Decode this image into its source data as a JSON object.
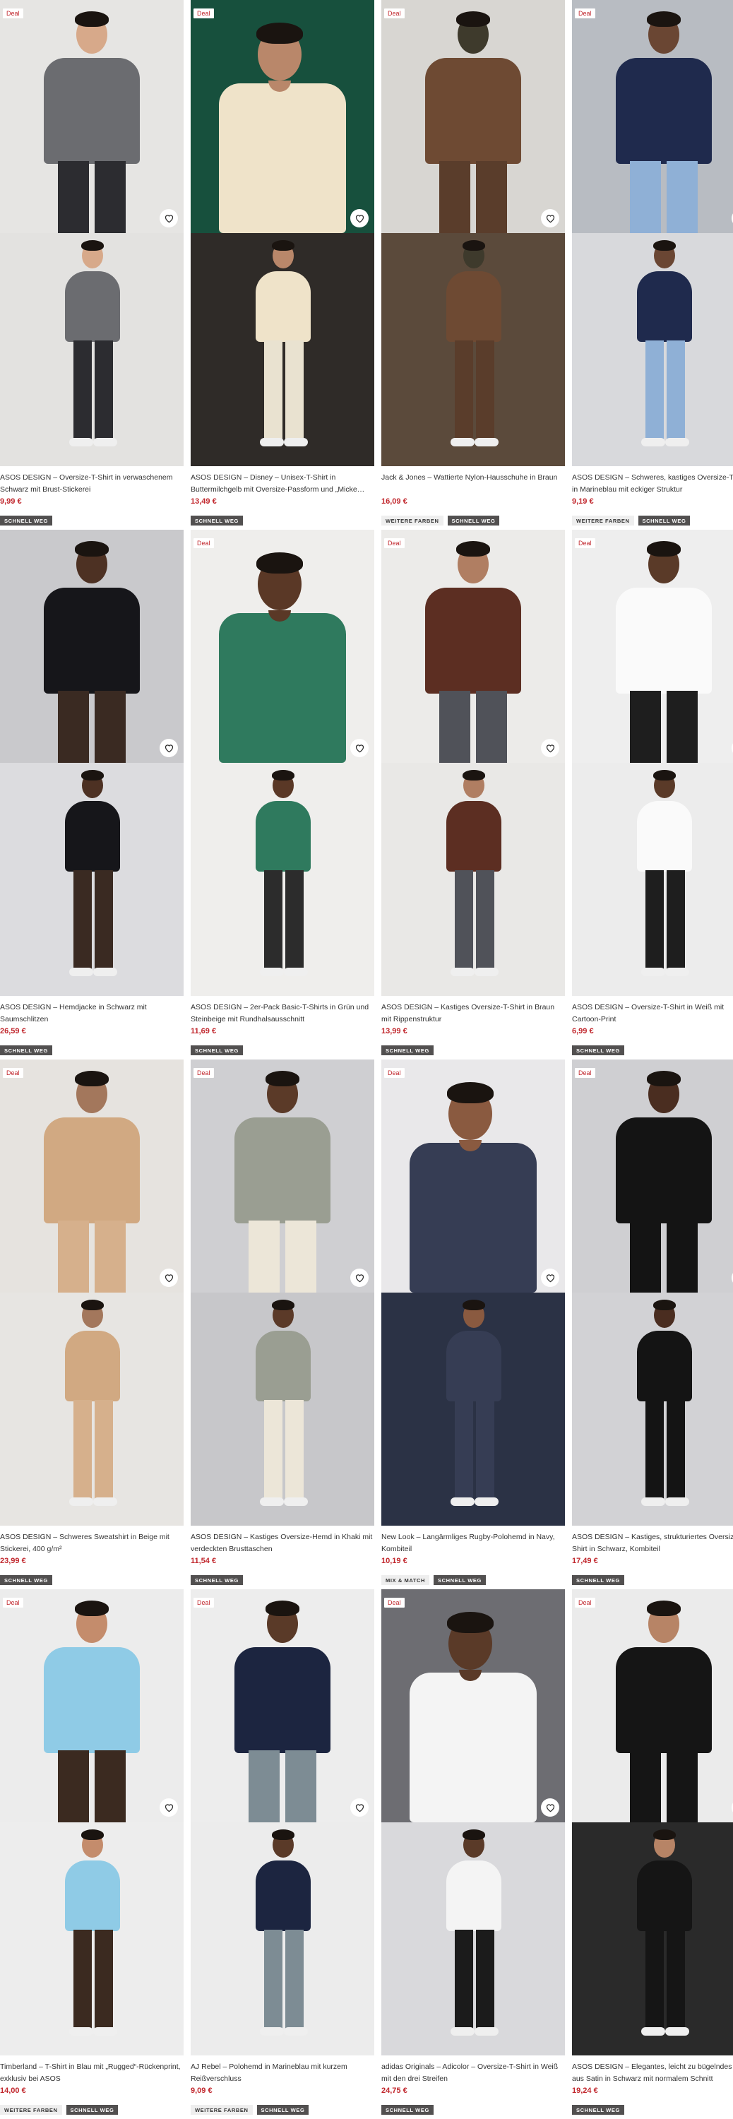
{
  "products": [
    {
      "title": "ASOS DESIGN – Oversize-T-Shirt in verwaschenem Schwarz mit Brust-Stickerei",
      "price": "9,99 €",
      "deal": "Deal",
      "badges": [
        "SCHNELL WEG"
      ],
      "colors": {
        "bg": "#e6e5e3",
        "bg2": "#e3e2e0",
        "shirt": "#6b6c70",
        "pants": "#2c2c30",
        "skin": "#d7a98a"
      }
    },
    {
      "title": "ASOS DESIGN – Disney – Unisex-T-Shirt in Buttermilchgelb mit Oversize-Passform und „Micke…",
      "price": "13,49 €",
      "deal": "Deal",
      "badges": [
        "SCHNELL WEG"
      ],
      "colors": {
        "bg": "#17503d",
        "bg2": "#2f2b28",
        "shirt": "#efe3c9",
        "pants": "#e9e2d0",
        "skin": "#b9876a"
      }
    },
    {
      "title": "Jack & Jones – Wattierte Nylon-Hausschuhe in Braun",
      "price": "16,09 €",
      "deal": "Deal",
      "badges": [
        "WEITERE FARBEN",
        "SCHNELL WEG"
      ],
      "colors": {
        "bg": "#d8d6d2",
        "bg2": "#5b4a3b",
        "shirt": "#6e4a33",
        "pants": "#5a3d2b",
        "skin": "#3e3a2c"
      }
    },
    {
      "title": "ASOS DESIGN – Schweres, kastiges Oversize-T-Shirt in Marineblau mit eckiger Struktur",
      "price": "9,19 €",
      "deal": "Deal",
      "badges": [
        "WEITERE FARBEN",
        "SCHNELL WEG"
      ],
      "colors": {
        "bg": "#b8bcc2",
        "bg2": "#d8d9dc",
        "shirt": "#1f2a4d",
        "pants": "#8fb0d6",
        "skin": "#6a4633"
      }
    },
    {
      "title": "ASOS DESIGN – Hemdjacke in Schwarz mit Saumschlitzen",
      "price": "26,59 €",
      "deal": "",
      "badges": [
        "SCHNELL WEG"
      ],
      "colors": {
        "bg": "#c9c9cc",
        "bg2": "#dcdcdf",
        "shirt": "#16161a",
        "pants": "#3a2a22",
        "skin": "#4d3123"
      }
    },
    {
      "title": "ASOS DESIGN – 2er-Pack Basic-T-Shirts in Grün und Steinbeige mit Rundhalsausschnitt",
      "price": "11,69 €",
      "deal": "Deal",
      "badges": [
        "SCHNELL WEG"
      ],
      "colors": {
        "bg": "#efeeec",
        "bg2": "#efeeec",
        "shirt": "#2f7a5e",
        "pants": "#2c2c2c",
        "skin": "#5a3826"
      }
    },
    {
      "title": "ASOS DESIGN – Kastiges Oversize-T-Shirt in Braun mit Rippenstruktur",
      "price": "13,99 €",
      "deal": "Deal",
      "badges": [
        "SCHNELL WEG"
      ],
      "colors": {
        "bg": "#ecebe9",
        "bg2": "#e9e8e6",
        "shirt": "#5c2e22",
        "pants": "#505259",
        "skin": "#b07e62"
      }
    },
    {
      "title": "ASOS DESIGN – Oversize-T-Shirt in Weiß mit Cartoon-Print",
      "price": "6,99 €",
      "deal": "Deal",
      "badges": [
        "SCHNELL WEG"
      ],
      "colors": {
        "bg": "#eeeeee",
        "bg2": "#ececec",
        "shirt": "#fafafa",
        "pants": "#1e1e1e",
        "skin": "#5a3a28"
      }
    },
    {
      "title": "ASOS DESIGN – Schweres Sweatshirt in Beige mit Stickerei, 400 g/m²",
      "price": "23,99 €",
      "deal": "Deal",
      "badges": [
        "SCHNELL WEG"
      ],
      "colors": {
        "bg": "#e6e3df",
        "bg2": "#e7e5e2",
        "shirt": "#d1a982",
        "pants": "#d6b08c",
        "skin": "#a3775c"
      }
    },
    {
      "title": "ASOS DESIGN – Kastiges Oversize-Hemd in Khaki mit verdeckten Brusttaschen",
      "price": "11,54 €",
      "deal": "Deal",
      "badges": [
        "SCHNELL WEG"
      ],
      "colors": {
        "bg": "#cfcfd2",
        "bg2": "#c7c7ca",
        "shirt": "#9a9e92",
        "pants": "#ece6d8",
        "skin": "#5b3a28"
      }
    },
    {
      "title": "New Look – Langärmliges Rugby-Polohemd in Navy, Kombiteil",
      "price": "10,19 €",
      "deal": "Deal",
      "badges": [
        "MIX & MATCH",
        "SCHNELL WEG"
      ],
      "colors": {
        "bg": "#e9e8ea",
        "bg2": "#2b3245",
        "shirt": "#363d54",
        "pants": "#363d54",
        "skin": "#8a5a40"
      }
    },
    {
      "title": "ASOS DESIGN – Kastiges, strukturiertes Oversize-Shirt in Schwarz, Kombiteil",
      "price": "17,49 €",
      "deal": "Deal",
      "badges": [
        "SCHNELL WEG"
      ],
      "colors": {
        "bg": "#cfcfd2",
        "bg2": "#d2d2d5",
        "shirt": "#141414",
        "pants": "#141414",
        "skin": "#4a2d20"
      }
    },
    {
      "title": "Timberland – T-Shirt in Blau mit „Rugged“-Rückenprint, exklusiv bei ASOS",
      "price": "14,00 €",
      "deal": "Deal",
      "badges": [
        "WEITERE FARBEN",
        "SCHNELL WEG"
      ],
      "colors": {
        "bg": "#ececec",
        "bg2": "#ededed",
        "shirt": "#8fcbe6",
        "pants": "#3b2a20",
        "skin": "#c48c6c"
      }
    },
    {
      "title": "AJ Rebel – Polohemd in Marineblau mit kurzem Reißverschluss",
      "price": "9,09 €",
      "deal": "Deal",
      "badges": [
        "WEITERE FARBEN",
        "SCHNELL WEG"
      ],
      "colors": {
        "bg": "#ededed",
        "bg2": "#ececec",
        "shirt": "#1c2540",
        "pants": "#7d8c94",
        "skin": "#5a3a28"
      }
    },
    {
      "title": "adidas Originals – Adicolor – Oversize-T-Shirt in Weiß mit den drei Streifen",
      "price": "24,75 €",
      "deal": "Deal",
      "badges": [
        "SCHNELL WEG"
      ],
      "colors": {
        "bg": "#6d6d72",
        "bg2": "#d9d9dc",
        "shirt": "#f4f4f4",
        "pants": "#1b1b1b",
        "skin": "#5a3a28"
      }
    },
    {
      "title": "ASOS DESIGN – Elegantes, leicht zu bügelndes Hemd aus Satin in Schwarz mit normalem Schnitt",
      "price": "19,24 €",
      "deal": "Deal",
      "badges": [
        "SCHNELL WEG"
      ],
      "colors": {
        "bg": "#ebebeb",
        "bg2": "#2a2a2a",
        "shirt": "#151515",
        "pants": "#151515",
        "skin": "#b78466"
      }
    }
  ],
  "icons": {
    "wishlist": "heart-outline-icon"
  }
}
